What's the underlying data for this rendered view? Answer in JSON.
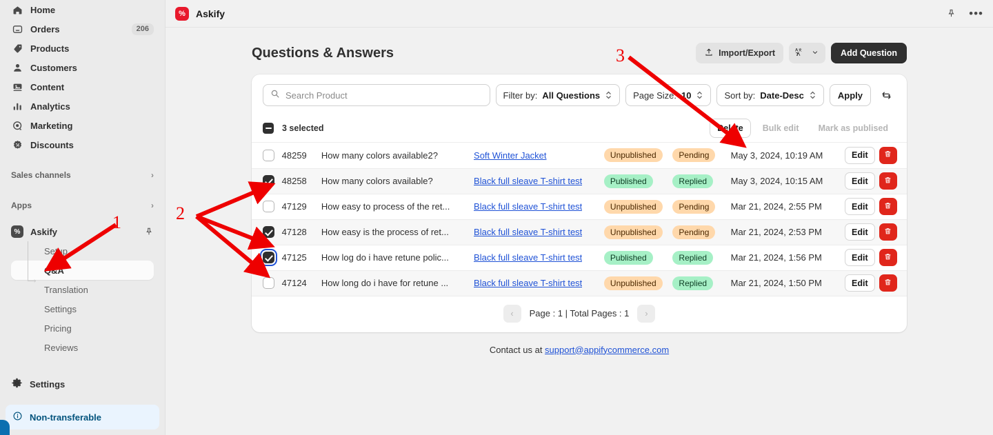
{
  "sidebar": {
    "nav": [
      {
        "label": "Home",
        "icon": "home-icon",
        "badge": ""
      },
      {
        "label": "Orders",
        "icon": "orders-inbox-icon",
        "badge": "206"
      },
      {
        "label": "Products",
        "icon": "products-tag-icon",
        "badge": ""
      },
      {
        "label": "Customers",
        "icon": "customers-person-icon",
        "badge": ""
      },
      {
        "label": "Content",
        "icon": "content-image-icon",
        "badge": ""
      },
      {
        "label": "Analytics",
        "icon": "analytics-bars-icon",
        "badge": ""
      },
      {
        "label": "Marketing",
        "icon": "marketing-target-icon",
        "badge": ""
      },
      {
        "label": "Discounts",
        "icon": "discounts-badge-icon",
        "badge": ""
      }
    ],
    "sections": [
      {
        "label": "Sales channels",
        "chevron": "chevron-right-icon"
      },
      {
        "label": "Apps",
        "chevron": "chevron-right-icon"
      }
    ],
    "app": {
      "name": "Askify",
      "logo_text": "%",
      "pin_icon": "pin-icon",
      "sub_items": [
        {
          "label": "Setup",
          "active": false
        },
        {
          "label": "Q&A",
          "active": true
        },
        {
          "label": "Translation",
          "active": false
        },
        {
          "label": "Settings",
          "active": false
        },
        {
          "label": "Pricing",
          "active": false
        },
        {
          "label": "Reviews",
          "active": false
        }
      ]
    },
    "settings": {
      "label": "Settings",
      "icon": "gear-icon"
    },
    "footer_badge": {
      "label": "Non-transferable",
      "icon": "info-icon"
    }
  },
  "topbar": {
    "logo_text": "%",
    "title": "Askify",
    "pin_icon": "pin-icon",
    "more_icon": "more-dots-icon",
    "more_label": "•••"
  },
  "page": {
    "title": "Questions & Answers",
    "actions": {
      "import_export": "Import/Export",
      "import_icon": "upload-icon",
      "language_icon": "translate-icon",
      "language_chevron": "chevron-down-icon",
      "add_question": "Add Question"
    }
  },
  "toolbar": {
    "search_placeholder": "Search Product",
    "search_value": "",
    "search_icon": "search-icon",
    "filter_label": "Filter by:",
    "filter_value": "All Questions",
    "pagesize_label": "Page Size:",
    "pagesize_value": "10",
    "sort_label": "Sort by:",
    "sort_value": "Date-Desc",
    "apply_label": "Apply",
    "refresh_icon": "refresh-icon"
  },
  "selection_bar": {
    "count_text": "3 selected",
    "delete_label": "Delete",
    "bulk_edit_label": "Bulk edit",
    "mark_published_label": "Mark as publised"
  },
  "table": {
    "rows": [
      {
        "checked": false,
        "focused": false,
        "id": "48259",
        "question": "How many colors available2?",
        "product": "Soft Winter Jacket",
        "publish_status": "Unpublished",
        "reply_status": "Pending",
        "date": "May 3, 2024, 10:19 AM",
        "edit_label": "Edit",
        "delete_icon": "trash-icon"
      },
      {
        "checked": true,
        "focused": false,
        "id": "48258",
        "question": "How many colors available?",
        "product": "Black full sleave T-shirt test",
        "publish_status": "Published",
        "reply_status": "Replied",
        "date": "May 3, 2024, 10:15 AM",
        "edit_label": "Edit",
        "delete_icon": "trash-icon"
      },
      {
        "checked": false,
        "focused": false,
        "id": "47129",
        "question": "How easy to process of the ret...",
        "product": "Black full sleave T-shirt test",
        "publish_status": "Unpublished",
        "reply_status": "Pending",
        "date": "Mar 21, 2024, 2:55 PM",
        "edit_label": "Edit",
        "delete_icon": "trash-icon"
      },
      {
        "checked": true,
        "focused": false,
        "id": "47128",
        "question": "How easy is the process of ret...",
        "product": "Black full sleave T-shirt test",
        "publish_status": "Unpublished",
        "reply_status": "Pending",
        "date": "Mar 21, 2024, 2:53 PM",
        "edit_label": "Edit",
        "delete_icon": "trash-icon"
      },
      {
        "checked": true,
        "focused": true,
        "id": "47125",
        "question": "How log do i have retune polic...",
        "product": "Black full sleave T-shirt test",
        "publish_status": "Published",
        "reply_status": "Replied",
        "date": "Mar 21, 2024, 1:56 PM",
        "edit_label": "Edit",
        "delete_icon": "trash-icon"
      },
      {
        "checked": false,
        "focused": false,
        "id": "47124",
        "question": "How long do i have for retune ...",
        "product": "Black full sleave T-shirt test",
        "publish_status": "Unpublished",
        "reply_status": "Replied",
        "date": "Mar 21, 2024, 1:50 PM",
        "edit_label": "Edit",
        "delete_icon": "trash-icon"
      }
    ]
  },
  "pagination": {
    "prev_icon": "chevron-left-icon",
    "next_icon": "chevron-right-icon",
    "text": "Page : 1 | Total Pages : 1"
  },
  "footer": {
    "text": "Contact us at ",
    "email": "support@appifycommerce.com"
  },
  "annotations": {
    "color": "#ee0000",
    "markers": [
      {
        "label": "1",
        "target": "sidebar-qa-item"
      },
      {
        "label": "2",
        "target": "row-checkboxes"
      },
      {
        "label": "3",
        "target": "delete-button"
      }
    ]
  }
}
